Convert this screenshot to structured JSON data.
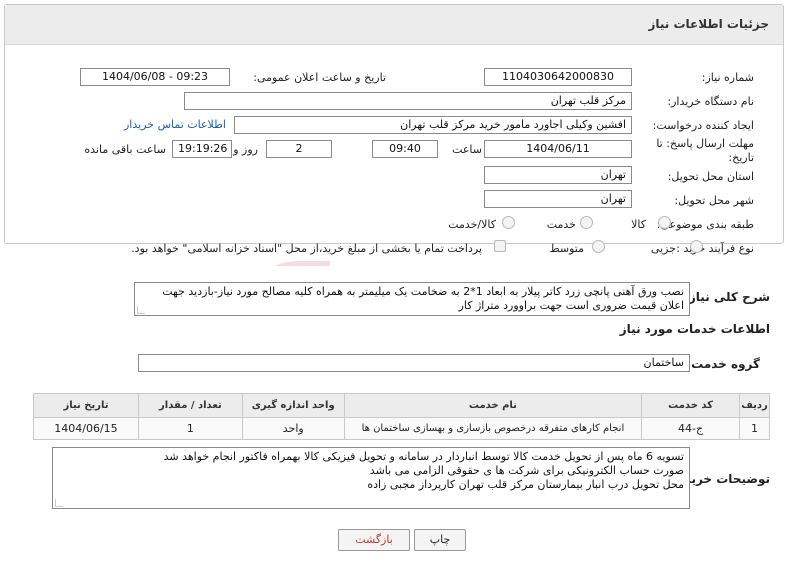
{
  "header": {
    "title": "جزئیات اطلاعات نیاز"
  },
  "form": {
    "need_number_label": "شماره نیاز:",
    "need_number": "1104030642000830",
    "announce_label": "تاریخ و ساعت اعلان عمومی:",
    "announce_value": "1404/06/08 - 09:23",
    "buyer_org_label": "نام دستگاه خریدار:",
    "buyer_org": "مرکز قلب تهران",
    "creator_label": "ایجاد کننده درخواست:",
    "creator": "افشین وکیلی اجاورد مامور خرید مرکز قلب تهران",
    "contact_link": "اطلاعات تماس خریدار",
    "deadline_label_1": "مهلت ارسال پاسخ: تا",
    "deadline_label_2": "تاریخ:",
    "deadline_date": "1404/06/11",
    "time_label": "ساعت",
    "deadline_time": "09:40",
    "days_value": "2",
    "days_label": "روز و",
    "remaining_time": "19:19:26",
    "remaining_label": "ساعت باقی مانده",
    "province_label": "استان محل تحویل:",
    "province": "تهران",
    "city_label": "شهر محل تحویل:",
    "city": "تهران",
    "category_label": "طبقه بندی موضوعی:",
    "category_options": [
      "کالا",
      "خدمت",
      "کالا/خدمت"
    ],
    "process_label": "نوع فرآیند خرید :",
    "process_options": [
      "جزیی",
      "متوسط"
    ],
    "payment_note": "پرداخت تمام یا بخشی از مبلغ خرید،از محل \"اسناد خزانه اسلامی\" خواهد بود."
  },
  "need": {
    "desc_label": "شرح کلی نیاز:",
    "desc_text": "نصب ورق آهنی پانچی زرد کاتر پیلار به ابعاد 1*2 به ضخامت یک میلیمتر به همراه کلیه مصالح مورد نیاز-بازدید جهت اعلان قیمت ضروری است جهت براوورد متراژ کار",
    "services_title": "اطلاعات خدمات مورد نیاز",
    "service_group_label": "گروه خدمت:",
    "service_group": "ساختمان"
  },
  "table": {
    "headers": [
      "ردیف",
      "کد خدمت",
      "نام خدمت",
      "واحد اندازه گیری",
      "تعداد / مقدار",
      "تاریخ نیاز"
    ],
    "rows": [
      [
        "1",
        "ج-44",
        "انجام کارهای متفرقه درخصوص بازسازی و بهسازی ساختمان ها",
        "واحد",
        "1",
        "1404/06/15"
      ]
    ]
  },
  "buyer_notes": {
    "label": "توضیحات خریدار:",
    "lines": [
      "تسویه 6 ماه پس از تحویل خدمت کالا توسط انباردار در سامانه و تحویل فیزیکی کالا بهمراه فاکتور انجام خواهد شد",
      "صورت حساب الکترونیکی برای شرکت ها ی حقوقی الزامی می باشد",
      "محل تحویل درب انبار بیمارستان مرکز قلب تهران کارپرداز مجبی زاده"
    ]
  },
  "buttons": {
    "print": "چاپ",
    "back": "بازگشت"
  },
  "colors": {
    "header_bg": "#ececec",
    "link": "#1a5fb4",
    "back_text": "#c0392b",
    "watermark": "#f4d6d6"
  }
}
